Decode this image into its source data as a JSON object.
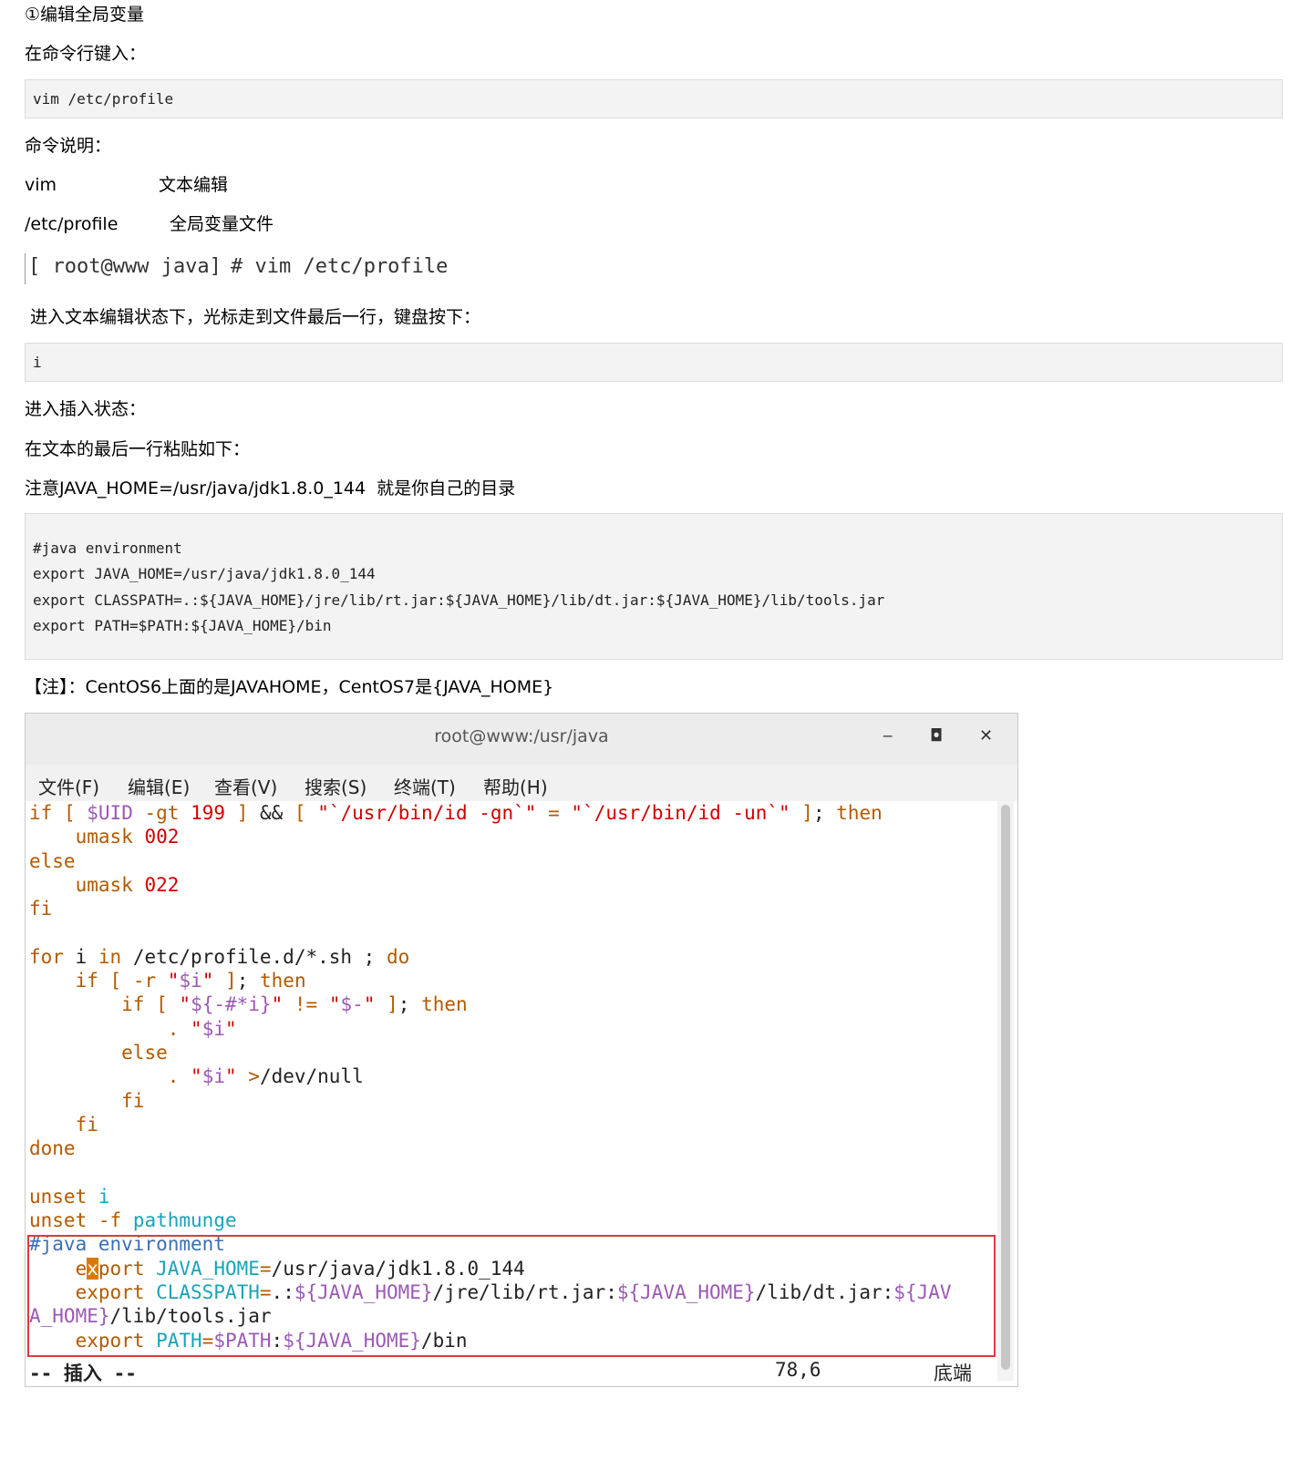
{
  "paragraphs": {
    "step_title": "①编辑全局变量",
    "enter_cmd": "在命令行键入：",
    "cmd_desc_title": "命令说明：",
    "vim_label": "vim",
    "vim_desc": "文本编辑",
    "profile_label": "/etc/profile",
    "profile_desc": "全局变量文件",
    "edit_state": " 进入文本编辑状态下，光标走到文件最后一行，键盘按下：",
    "insert_state": "进入插入状态：",
    "paste_text": "在文本的最后一行粘贴如下：",
    "note_home": "注意JAVA_HOME=/usr/java/jdk1.8.0_144  就是你自己的目录",
    "note_centos": "【注】：CentOS6上面的是JAVAHOME，CentOS7是{JAVA_HOME}"
  },
  "code_blocks": {
    "vim_cmd": "vim /etc/profile",
    "insert_key": "i",
    "env_lines": [
      "#java environment",
      "export JAVA_HOME=/usr/java/jdk1.8.0_144",
      "export CLASSPATH=.:${JAVA_HOME}/jre/lib/rt.jar:${JAVA_HOME}/lib/dt.jar:${JAVA_HOME}/lib/tools.jar",
      "export PATH=$PATH:${JAVA_HOME}/bin"
    ]
  },
  "shell_prompt": {
    "prompt": "[ root@www java]",
    "command": "# vim /etc/profile"
  },
  "terminal": {
    "title": "root@www:/usr/java",
    "minimize": "‒",
    "maximize": "◘",
    "close": "✕",
    "menu": [
      "文件(F)",
      "编辑(E)",
      "查看(V)",
      "搜索(S)",
      "终端(T)",
      "帮助(H)"
    ],
    "status_mode": "-- 插入 --",
    "status_pos": "78,6",
    "status_end": "底端"
  },
  "colors": {
    "keyword": "#b35a00",
    "string": "#d10000",
    "variable": "#9b59b6",
    "cyan": "#1aa3b8",
    "comment": "#3b6fb6",
    "highlight_box": "#e0393e"
  }
}
